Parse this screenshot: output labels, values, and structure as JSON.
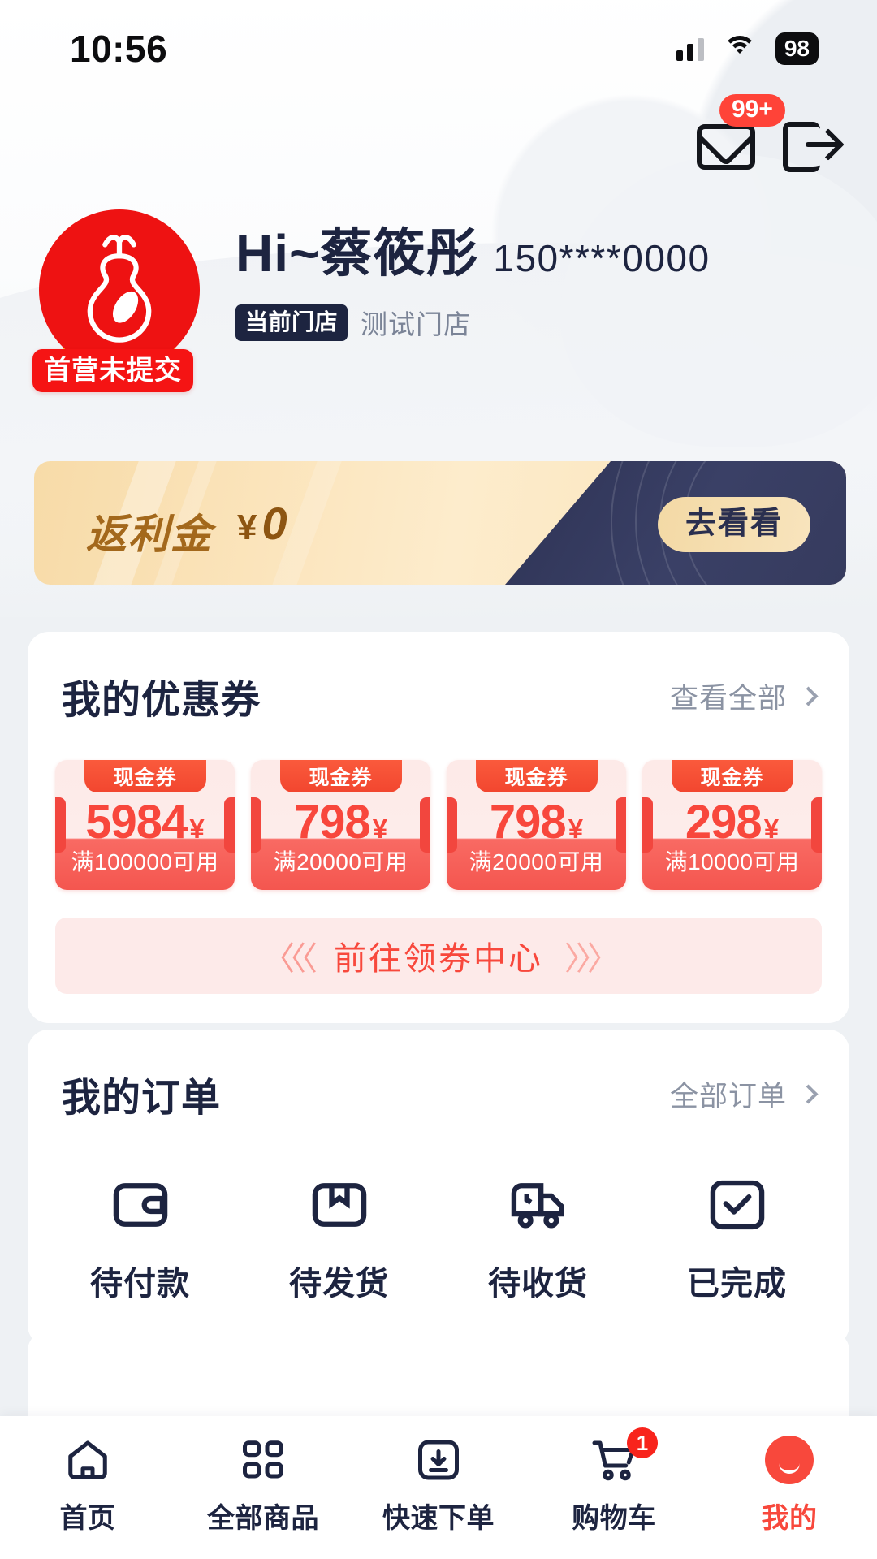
{
  "status_bar": {
    "time": "10:56",
    "battery": "98",
    "signal_icon": "signal-bars-icon",
    "wifi_icon": "wifi-icon"
  },
  "top_actions": {
    "mail_icon": "mail-icon",
    "mail_badge": "99+",
    "logout_icon": "logout-icon"
  },
  "profile": {
    "avatar_icon": "gourd-avatar-icon",
    "avatar_badge": "首营未提交",
    "greeting": "Hi~蔡筱彤",
    "phone": "150****0000",
    "store_tag": "当前门店",
    "store_name": "测试门店"
  },
  "rebate": {
    "label": "返利金",
    "currency": "¥",
    "amount": "0",
    "button": "去看看"
  },
  "coupons": {
    "title": "我的优惠券",
    "more": "查看全部",
    "items": [
      {
        "tag": "现金券",
        "amount": "5984",
        "currency": "¥",
        "condition": "满100000可用"
      },
      {
        "tag": "现金券",
        "amount": "798",
        "currency": "¥",
        "condition": "满20000可用"
      },
      {
        "tag": "现金券",
        "amount": "798",
        "currency": "¥",
        "condition": "满20000可用"
      },
      {
        "tag": "现金券",
        "amount": "298",
        "currency": "¥",
        "condition": "满10000可用"
      }
    ],
    "cta_left_arrows": "〈〈〈",
    "cta_text": "前往领券中心",
    "cta_right_arrows": "〉〉〉"
  },
  "orders": {
    "title": "我的订单",
    "more": "全部订单",
    "items": [
      {
        "label": "待付款",
        "icon": "wallet-icon"
      },
      {
        "label": "待发货",
        "icon": "package-icon"
      },
      {
        "label": "待收货",
        "icon": "truck-icon"
      },
      {
        "label": "已完成",
        "icon": "check-box-icon"
      }
    ]
  },
  "tabbar": {
    "items": [
      {
        "label": "首页",
        "icon": "home-icon",
        "active": false
      },
      {
        "label": "全部商品",
        "icon": "grid-icon",
        "active": false
      },
      {
        "label": "快速下单",
        "icon": "quick-order-icon",
        "active": false
      },
      {
        "label": "购物车",
        "icon": "cart-icon",
        "active": false,
        "badge": "1"
      },
      {
        "label": "我的",
        "icon": "profile-icon",
        "active": true
      }
    ]
  },
  "colors": {
    "accent_red": "#f8483c",
    "navy": "#1d2440",
    "gold": "#a3681c",
    "page_bg": "#eef1f4"
  }
}
